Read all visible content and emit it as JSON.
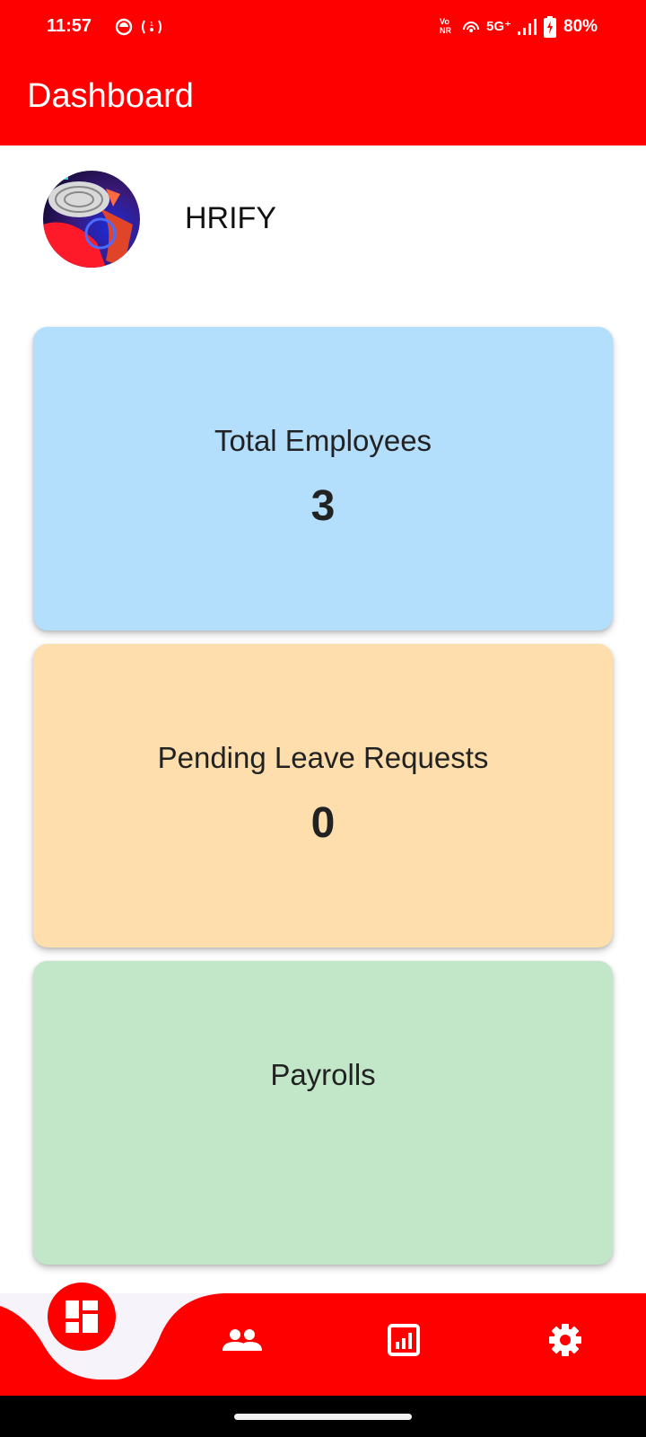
{
  "status_bar": {
    "time": "11:57",
    "network": "5G⁺",
    "vonr_top": "Vo",
    "vonr_bottom": "NR",
    "battery": "80%"
  },
  "app_bar": {
    "title": "Dashboard"
  },
  "profile": {
    "company": "HRIFY"
  },
  "cards": {
    "employees": {
      "title": "Total Employees",
      "value": "3",
      "color": "#b3defc"
    },
    "leave": {
      "title": "Pending Leave Requests",
      "value": "0",
      "color": "#fddeac"
    },
    "payroll": {
      "title": "Payrolls",
      "color": "#c1e7c8"
    }
  },
  "bottom_nav": {
    "items": [
      {
        "icon": "dashboard-icon",
        "active": true
      },
      {
        "icon": "people-icon",
        "active": false
      },
      {
        "icon": "report-icon",
        "active": false
      },
      {
        "icon": "settings-icon",
        "active": false
      }
    ]
  },
  "theme": {
    "primary": "#ff0000"
  }
}
